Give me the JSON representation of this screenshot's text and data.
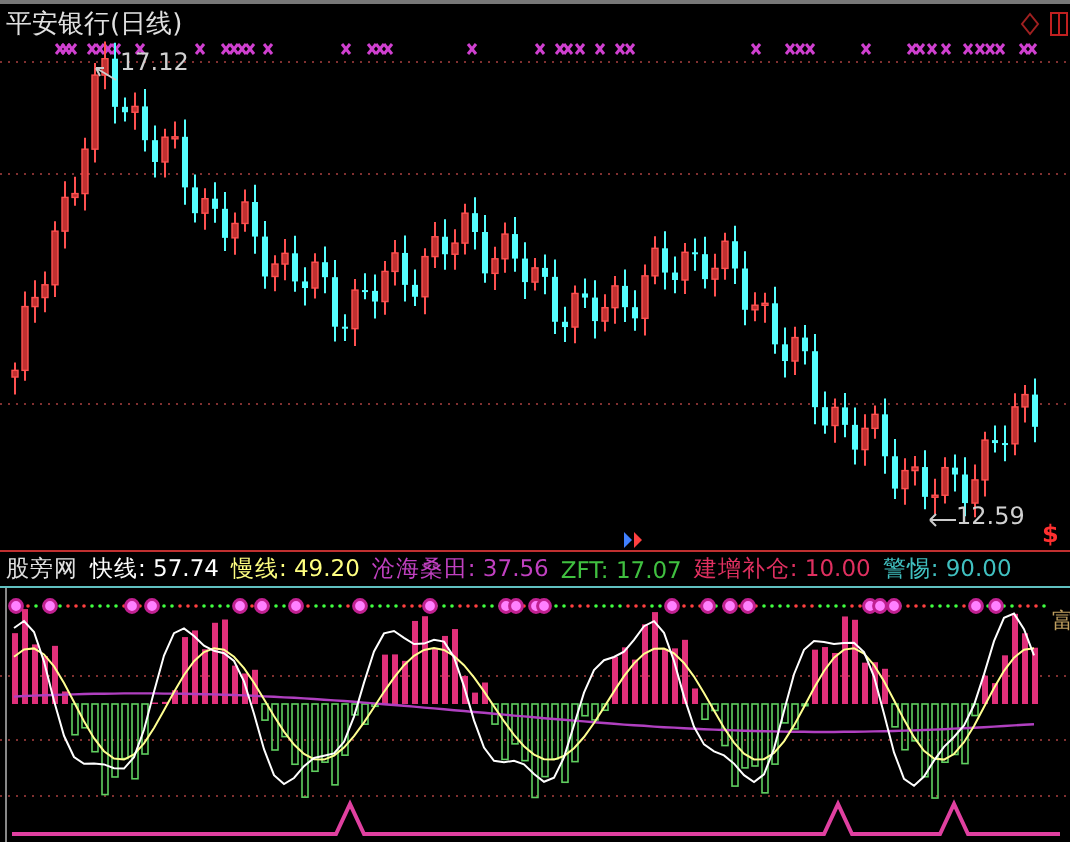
{
  "chart": {
    "title": "平安银行(日线)",
    "high_label": "17.12",
    "low_label": "12.59",
    "marker": "$"
  },
  "indicator": {
    "name": "股旁网",
    "corner": "富",
    "values": [
      {
        "text": "快线: 57.74",
        "color": "#ffffff"
      },
      {
        "text": "慢线: 49.20",
        "color": "#ffff80"
      },
      {
        "text": "沧海桑田: 37.56",
        "color": "#c040c0"
      },
      {
        "text": "ZFT: 17.07",
        "color": "#40c040"
      },
      {
        "text": "建增补仓: 10.00",
        "color": "#e03060"
      },
      {
        "text": "警惕: 90.00",
        "color": "#40c0c0"
      }
    ]
  }
}
